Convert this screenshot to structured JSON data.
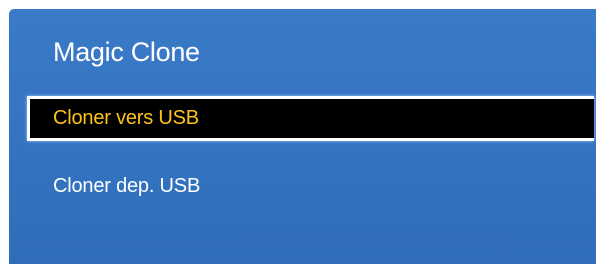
{
  "menu": {
    "title": "Magic Clone",
    "items": [
      {
        "label": "Cloner vers USB",
        "selected": true
      },
      {
        "label": "Cloner dep. USB",
        "selected": false
      }
    ]
  },
  "colors": {
    "panel_background": "#3575c3",
    "selected_background": "#000000",
    "selected_text": "#ffc21a",
    "text": "#ffffff"
  }
}
